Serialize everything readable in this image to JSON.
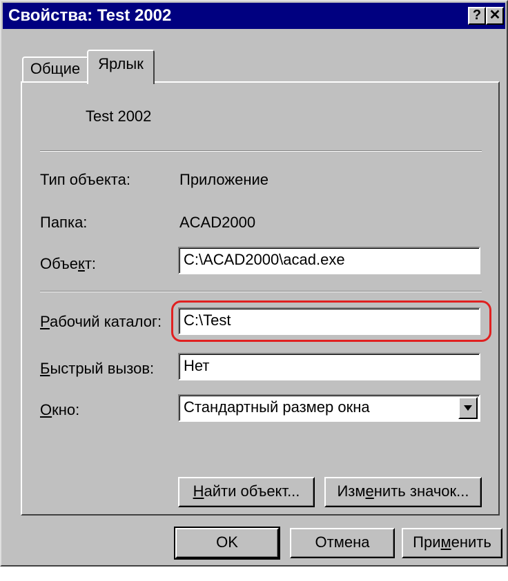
{
  "window": {
    "title": "Свойства: Test 2002"
  },
  "titlebar_buttons": {
    "help": "?",
    "close": "✕"
  },
  "tabs": [
    {
      "label": "Общие",
      "active": false
    },
    {
      "label": "Ярлык",
      "active": true
    }
  ],
  "shortcut": {
    "name": "Test 2002",
    "type_label": "Тип объекта:",
    "type_value": "Приложение",
    "folder_label": "Папка:",
    "folder_value": "ACAD2000",
    "target_label_pre": "Объе",
    "target_label_key": "к",
    "target_label_post": "т:",
    "target_value": "C:\\ACAD2000\\acad.exe",
    "workdir_label_key": "Р",
    "workdir_label_post": "абочий каталог:",
    "workdir_value": "C:\\Test",
    "hotkey_label_key": "Б",
    "hotkey_label_post": "ыстрый вызов:",
    "hotkey_value": "Нет",
    "window_label_key": "О",
    "window_label_post": "кно:",
    "window_value": "Стандартный размер окна"
  },
  "panel_buttons": {
    "find_key": "Н",
    "find_post": "айти объект...",
    "change_pre": "Изм",
    "change_key": "е",
    "change_post": "нить значок..."
  },
  "dialog_buttons": {
    "ok": "OK",
    "cancel": "Отмена",
    "apply_pre": "При",
    "apply_key": "м",
    "apply_post": "енить"
  },
  "colors": {
    "highlight": "#e02020",
    "titlebar": "#000080",
    "face": "#c0c0c0"
  }
}
